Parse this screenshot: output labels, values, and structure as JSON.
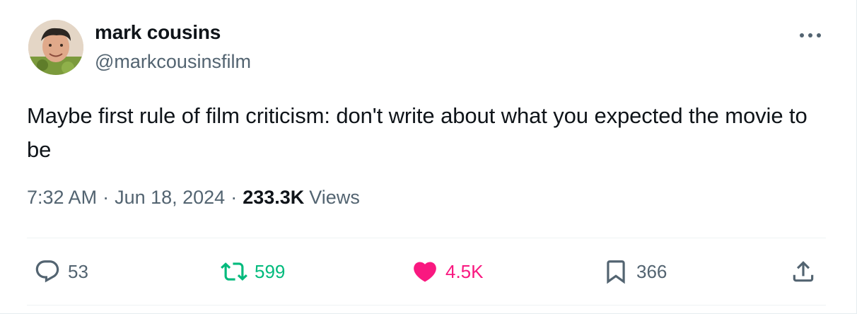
{
  "author": {
    "display_name": "mark cousins",
    "handle": "@markcousinsfilm"
  },
  "tweet": {
    "text": "Maybe first rule of film criticism: don't write about what you expected the movie to be"
  },
  "meta": {
    "time": "7:32 AM",
    "separator": "·",
    "date": "Jun 18, 2024",
    "views_count": "233.3K",
    "views_label": "Views"
  },
  "actions": {
    "replies": "53",
    "reposts": "599",
    "likes": "4.5K",
    "bookmarks": "366"
  },
  "icons": {
    "more": "more-horizontal-icon",
    "reply": "reply-icon",
    "repost": "repost-icon",
    "like": "heart-filled-icon",
    "bookmark": "bookmark-icon",
    "share": "share-icon"
  },
  "colors": {
    "text_primary": "#0f1419",
    "text_secondary": "#536471",
    "repost_active": "#00ba7c",
    "like_active": "#f91880"
  }
}
